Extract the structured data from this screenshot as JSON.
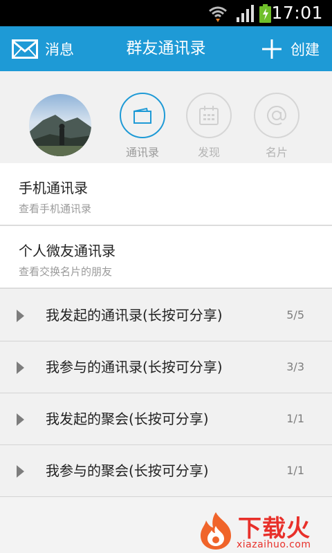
{
  "status_bar": {
    "time": "17:01"
  },
  "header": {
    "left_label": "消息",
    "title": "群友通讯录",
    "right_label": "创建"
  },
  "profile_tabs": [
    {
      "label": "通讯录",
      "icon": "card-icon",
      "active": true
    },
    {
      "label": "发现",
      "icon": "calendar-icon",
      "active": false
    },
    {
      "label": "名片",
      "icon": "at-icon",
      "active": false
    }
  ],
  "address_books": [
    {
      "title": "手机通讯录",
      "subtitle": "查看手机通讯录"
    },
    {
      "title": "个人微友通讯录",
      "subtitle": "查看交换名片的朋友"
    }
  ],
  "groups": [
    {
      "label": "我发起的通讯录(长按可分享)",
      "count": "5/5"
    },
    {
      "label": "我参与的通讯录(长按可分享)",
      "count": "3/3"
    },
    {
      "label": "我发起的聚会(长按可分享)",
      "count": "1/1"
    },
    {
      "label": "我参与的聚会(长按可分享)",
      "count": "1/1"
    }
  ],
  "watermark": {
    "brand": "下载火",
    "domain": "xiazaihuo.com"
  },
  "colors": {
    "header": "#1e9ad6",
    "watermark": "#e8302a"
  }
}
